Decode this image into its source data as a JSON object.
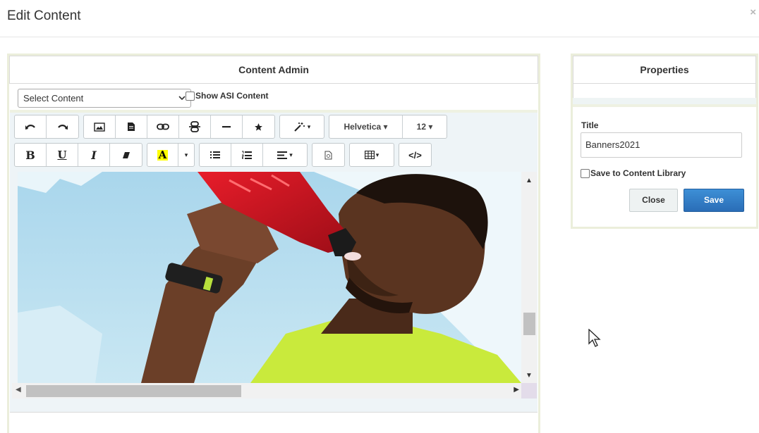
{
  "modal": {
    "title": "Edit Content",
    "close_glyph": "×"
  },
  "content_admin": {
    "title": "Content Admin",
    "select": {
      "value": "Select Content",
      "chevron": "⌄"
    },
    "show_asi_label": "Show ASI Content"
  },
  "toolbar": {
    "font": "Helvetica ▾",
    "size": "12 ▾",
    "buttons_row1": [
      "undo-icon",
      "redo-icon",
      "image-icon",
      "file-icon",
      "link-icon",
      "unlink-icon",
      "horizontal-rule-icon",
      "star-icon",
      "magic-wand-icon"
    ],
    "buttons_row2": [
      "bold-icon",
      "underline-icon",
      "italic-icon",
      "eraser-icon",
      "highlight-icon",
      "unordered-list-icon",
      "ordered-list-icon",
      "align-icon",
      "document-icon",
      "table-icon",
      "code-icon"
    ],
    "bold": "B",
    "underline": "U",
    "italic": "I",
    "highlight": "A",
    "code": "</>",
    "caret": "▾"
  },
  "editor": {
    "image_description": "banner-image"
  },
  "properties": {
    "title": "Properties",
    "title_label": "Title",
    "title_value": "Banners2021",
    "save_library_label": "Save to Content Library",
    "close_label": "Close",
    "save_label": "Save"
  },
  "colors": {
    "primary": "#2a6db7",
    "panel_border": "#ebeedb",
    "editor_bg": "#eef4f7"
  }
}
